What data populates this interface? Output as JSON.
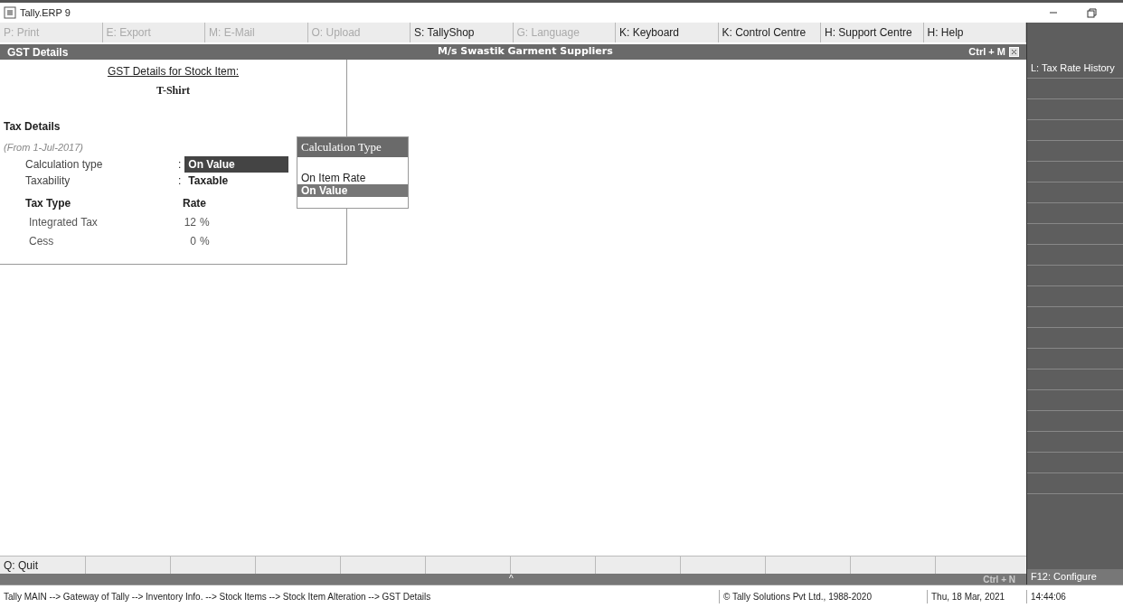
{
  "window": {
    "title": "Tally.ERP 9"
  },
  "top_menu": [
    {
      "label": "P: Print",
      "disabled": true
    },
    {
      "label": "E: Export",
      "disabled": true
    },
    {
      "label": "M: E-Mail",
      "disabled": true
    },
    {
      "label": "O: Upload",
      "disabled": true
    },
    {
      "label": "S: TallyShop",
      "disabled": false
    },
    {
      "label": "G: Language",
      "disabled": true
    },
    {
      "label": "K: Keyboard",
      "disabled": false
    },
    {
      "label": "K: Control Centre",
      "disabled": false
    },
    {
      "label": "H: Support Centre",
      "disabled": false
    },
    {
      "label": "H: Help",
      "disabled": false
    }
  ],
  "header": {
    "title": "GST Details",
    "company": "M/s Swastik Garment Suppliers",
    "shortcut": "Ctrl + M"
  },
  "panel": {
    "heading": "GST Details for Stock Item:",
    "item": "T-Shirt",
    "section": "Tax Details",
    "period": "(From 1-Jul-2017)",
    "fields": [
      {
        "label": "Calculation type",
        "separator": ":",
        "value": "On Value",
        "focused": true
      },
      {
        "label": "Taxability",
        "separator": ":",
        "value": "Taxable",
        "focused": false
      }
    ],
    "columns": [
      "Tax Type",
      "Rate"
    ],
    "rows": [
      {
        "tax": "Integrated Tax",
        "rate": "12",
        "unit": "%"
      },
      {
        "tax": "Cess",
        "rate": "0",
        "unit": "%"
      }
    ]
  },
  "popup": {
    "title": "Calculation Type",
    "items": [
      {
        "label": "On Item Rate",
        "selected": false
      },
      {
        "label": "On Value",
        "selected": true
      }
    ]
  },
  "side_buttons": [
    {
      "label": "L: Tax Rate History"
    }
  ],
  "bottom_buttons": [
    {
      "label": "Q: Quit"
    }
  ],
  "bottom_bar": {
    "caret": "^",
    "shortcut": "Ctrl + N"
  },
  "configure": {
    "label": "F12: Configure"
  },
  "status_bar": {
    "path": "Tally MAIN --> Gateway of Tally --> Inventory Info. --> Stock Items --> Stock Item Alteration --> GST Details",
    "copyright": "© Tally Solutions Pvt Ltd., 1988-2020",
    "date": "Thu, 18 Mar, 2021",
    "time": "14:44:06"
  }
}
